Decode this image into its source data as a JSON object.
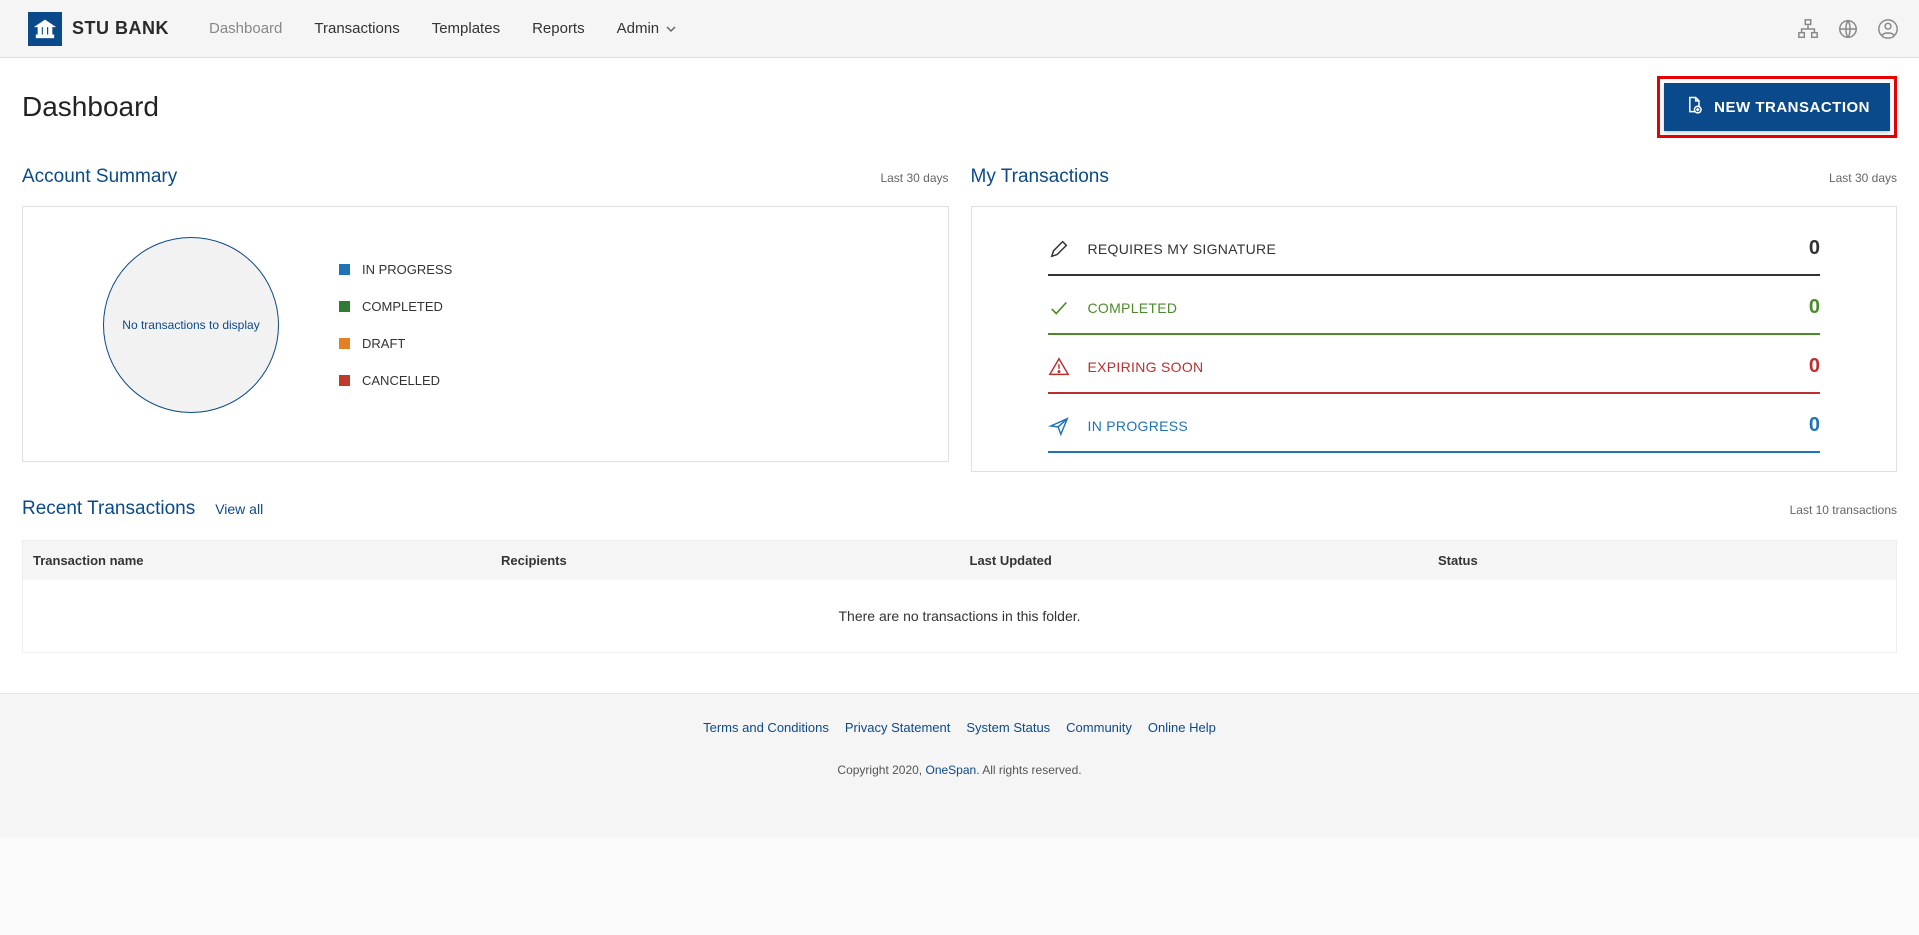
{
  "brand": {
    "name": "STU BANK"
  },
  "nav": {
    "dashboard": "Dashboard",
    "transactions": "Transactions",
    "templates": "Templates",
    "reports": "Reports",
    "admin": "Admin"
  },
  "page": {
    "title": "Dashboard",
    "new_tx_label": "NEW TRANSACTION"
  },
  "summary": {
    "title": "Account Summary",
    "range": "Last 30 days",
    "empty": "No transactions to display",
    "legend": {
      "in_progress": {
        "label": "IN PROGRESS",
        "color": "#1f73b7"
      },
      "completed": {
        "label": "COMPLETED",
        "color": "#2e7d32"
      },
      "draft": {
        "label": "DRAFT",
        "color": "#e67e22"
      },
      "cancelled": {
        "label": "CANCELLED",
        "color": "#c0392b"
      }
    }
  },
  "mytx": {
    "title": "My Transactions",
    "range": "Last 30 days",
    "rows": {
      "signature": {
        "label": "REQUIRES MY SIGNATURE",
        "count": "0",
        "color": "#333333"
      },
      "completed": {
        "label": "COMPLETED",
        "count": "0",
        "color": "#4b8a2a"
      },
      "expiring": {
        "label": "EXPIRING SOON",
        "count": "0",
        "color": "#b8312f"
      },
      "inprogress": {
        "label": "IN PROGRESS",
        "count": "0",
        "color": "#1f73b7"
      }
    }
  },
  "recent": {
    "title": "Recent Transactions",
    "view_all": "View all",
    "range": "Last 10 transactions",
    "columns": {
      "name": "Transaction name",
      "recipients": "Recipients",
      "updated": "Last Updated",
      "status": "Status"
    },
    "empty": "There are no transactions in this folder."
  },
  "footer": {
    "links": {
      "terms": "Terms and Conditions",
      "privacy": "Privacy Statement",
      "status": "System Status",
      "community": "Community",
      "help": "Online Help"
    },
    "copy_prefix": "Copyright 2020, ",
    "copy_brand": "OneSpan",
    "copy_suffix": ". All rights reserved."
  },
  "chart_data": {
    "type": "pie",
    "title": "Account Summary",
    "categories": [
      "IN PROGRESS",
      "COMPLETED",
      "DRAFT",
      "CANCELLED"
    ],
    "values": [
      0,
      0,
      0,
      0
    ],
    "colors": [
      "#1f73b7",
      "#2e7d32",
      "#e67e22",
      "#c0392b"
    ],
    "note": "No transactions to display"
  }
}
